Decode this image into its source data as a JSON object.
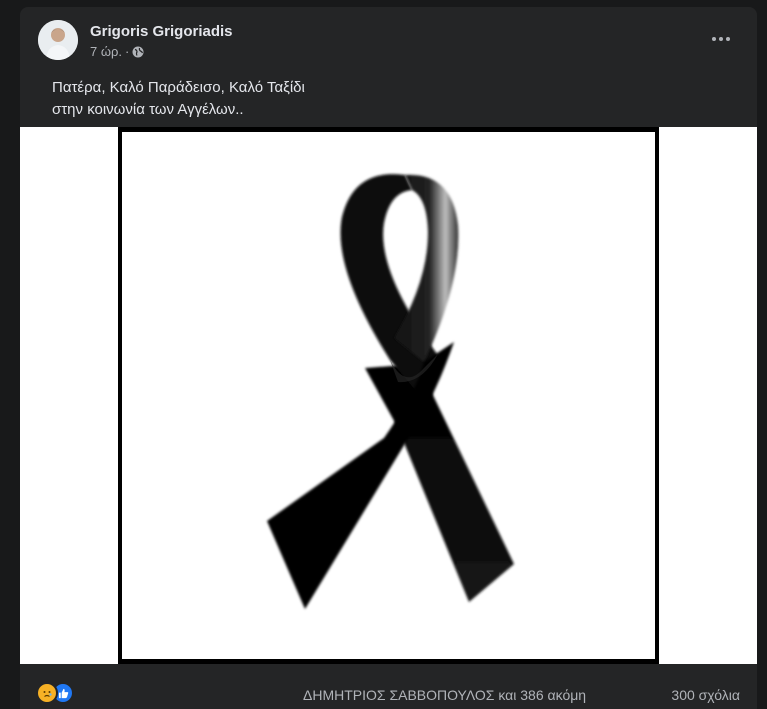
{
  "post": {
    "author": "Grigoris Grigoriadis",
    "time": "7 ώρ.",
    "separator": "·",
    "privacy_icon": "globe-icon",
    "more_icon": "more-horizontal-icon",
    "text_lines": [
      "Πατέρα, Καλό Παράδεισο, Καλό Ταξίδι",
      "στην κοινωνία των Αγγέλων.."
    ],
    "image_subject": "black-mourning-ribbon",
    "reactions": {
      "icons": [
        "sad-reaction-icon",
        "like-reaction-icon"
      ],
      "summary": "ΔΗΜΗΤΡΙΟΣ ΣΑΒΒΟΠΟΥΛΟΣ και 386 ακόμη",
      "comments": "300 σχόλια"
    }
  },
  "colors": {
    "page_bg": "#18191a",
    "card_bg": "#242526",
    "primary_text": "#e4e6eb",
    "secondary_text": "#b0b3b8",
    "like_blue": "#2078f4",
    "sad_yellow": "#f7b125"
  }
}
